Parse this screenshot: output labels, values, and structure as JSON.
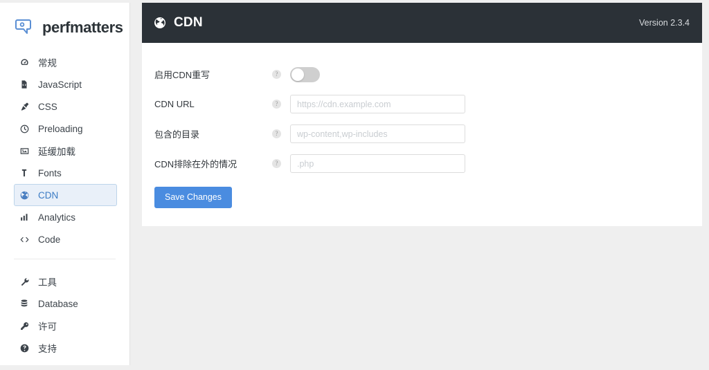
{
  "brand": {
    "name": "perfmatters",
    "logo_icon": "perfmatters-logo-icon"
  },
  "sidebar": {
    "primary_items": [
      {
        "label": "常规",
        "icon": "gauge-icon",
        "active": false
      },
      {
        "label": "JavaScript",
        "icon": "file-code-icon",
        "active": false
      },
      {
        "label": "CSS",
        "icon": "brush-icon",
        "active": false
      },
      {
        "label": "Preloading",
        "icon": "clock-icon",
        "active": false
      },
      {
        "label": "延缓加载",
        "icon": "image-icon",
        "active": false
      },
      {
        "label": "Fonts",
        "icon": "font-case-icon",
        "active": false
      },
      {
        "label": "CDN",
        "icon": "globe-icon",
        "active": true
      },
      {
        "label": "Analytics",
        "icon": "bar-chart-icon",
        "active": false
      },
      {
        "label": "Code",
        "icon": "code-icon",
        "active": false
      }
    ],
    "secondary_items": [
      {
        "label": "工具",
        "icon": "wrench-icon",
        "active": false
      },
      {
        "label": "Database",
        "icon": "database-icon",
        "active": false
      },
      {
        "label": "许可",
        "icon": "key-icon",
        "active": false
      },
      {
        "label": "支持",
        "icon": "question-mark-icon",
        "active": false
      }
    ]
  },
  "header": {
    "icon": "globe-icon",
    "title": "CDN",
    "version": "Version 2.3.4"
  },
  "form": {
    "help_symbol": "?",
    "rows": [
      {
        "label": "启用CDN重写",
        "type": "toggle",
        "value": "off",
        "placeholder": ""
      },
      {
        "label": "CDN URL",
        "type": "text",
        "value": "",
        "placeholder": "https://cdn.example.com"
      },
      {
        "label": "包含的目录",
        "type": "text",
        "value": "",
        "placeholder": "wp-content,wp-includes"
      },
      {
        "label": "CDN排除在外的情况",
        "type": "text",
        "value": "",
        "placeholder": ".php"
      }
    ],
    "save_label": "Save Changes"
  },
  "colors": {
    "accent_blue": "#4a8ce0",
    "header_dark": "#2b3137",
    "active_nav_bg": "#e9f0f9",
    "active_nav_text": "#3b7bc4",
    "page_bg": "#efefef"
  }
}
